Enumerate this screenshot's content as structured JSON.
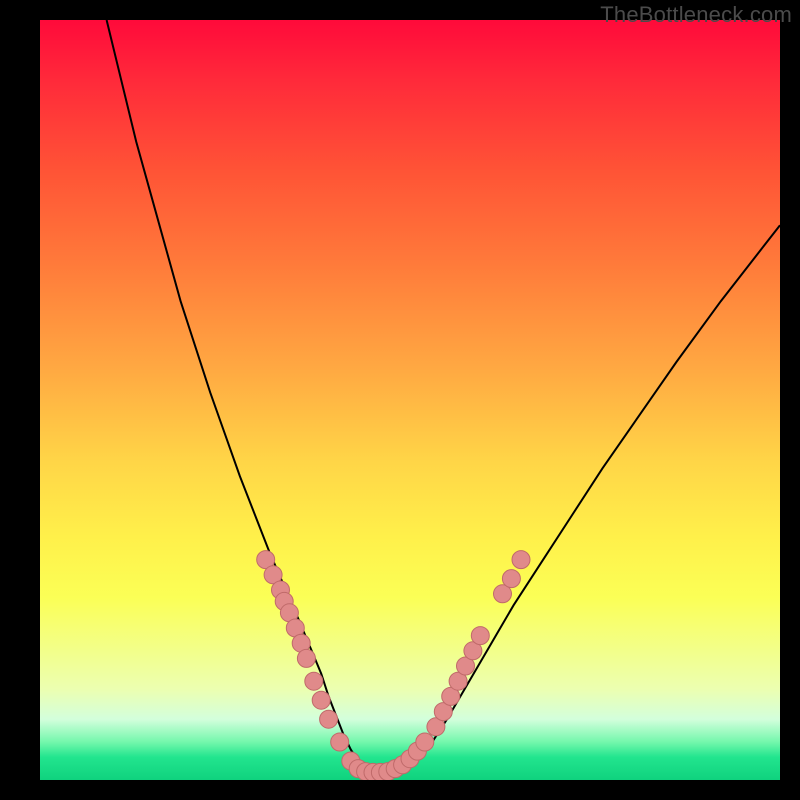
{
  "watermark": "TheBottleneck.com",
  "colors": {
    "curve_stroke": "#000000",
    "marker_fill": "#e08a8a",
    "marker_stroke": "#c06a6a"
  },
  "chart_data": {
    "type": "line",
    "title": "",
    "xlabel": "",
    "ylabel": "",
    "xlim": [
      0,
      100
    ],
    "ylim": [
      0,
      100
    ],
    "curve": {
      "x": [
        9,
        11,
        13,
        15,
        17,
        19,
        21,
        23,
        25,
        27,
        29,
        31,
        33,
        35,
        36.5,
        38,
        39,
        40,
        41,
        42,
        43,
        44,
        45,
        46,
        47.5,
        49,
        51,
        53,
        55,
        58,
        61,
        64,
        68,
        72,
        76,
        81,
        86,
        92,
        100
      ],
      "y": [
        100,
        92,
        84,
        77,
        70,
        63,
        57,
        51,
        45.5,
        40,
        35,
        30,
        25.5,
        21,
        17.5,
        14,
        11,
        8.5,
        6,
        4,
        2.5,
        1.5,
        1,
        1,
        1.2,
        1.8,
        3,
        5,
        8,
        13,
        18,
        23,
        29,
        35,
        41,
        48,
        55,
        63,
        73
      ]
    },
    "markers": [
      {
        "x": 30.5,
        "y": 29
      },
      {
        "x": 31.5,
        "y": 27
      },
      {
        "x": 32.5,
        "y": 25
      },
      {
        "x": 33.0,
        "y": 23.5
      },
      {
        "x": 33.7,
        "y": 22
      },
      {
        "x": 34.5,
        "y": 20
      },
      {
        "x": 35.3,
        "y": 18
      },
      {
        "x": 36.0,
        "y": 16
      },
      {
        "x": 37.0,
        "y": 13
      },
      {
        "x": 38.0,
        "y": 10.5
      },
      {
        "x": 39.0,
        "y": 8
      },
      {
        "x": 40.5,
        "y": 5
      },
      {
        "x": 42.0,
        "y": 2.5
      },
      {
        "x": 43.0,
        "y": 1.5
      },
      {
        "x": 44.0,
        "y": 1.1
      },
      {
        "x": 45.0,
        "y": 1.0
      },
      {
        "x": 46.0,
        "y": 1.0
      },
      {
        "x": 47.0,
        "y": 1.1
      },
      {
        "x": 48.0,
        "y": 1.5
      },
      {
        "x": 49.0,
        "y": 2.0
      },
      {
        "x": 50.0,
        "y": 2.8
      },
      {
        "x": 51.0,
        "y": 3.8
      },
      {
        "x": 52.0,
        "y": 5.0
      },
      {
        "x": 53.5,
        "y": 7.0
      },
      {
        "x": 54.5,
        "y": 9.0
      },
      {
        "x": 55.5,
        "y": 11.0
      },
      {
        "x": 56.5,
        "y": 13.0
      },
      {
        "x": 57.5,
        "y": 15.0
      },
      {
        "x": 58.5,
        "y": 17.0
      },
      {
        "x": 59.5,
        "y": 19.0
      },
      {
        "x": 62.5,
        "y": 24.5
      },
      {
        "x": 63.7,
        "y": 26.5
      },
      {
        "x": 65.0,
        "y": 29.0
      }
    ]
  }
}
